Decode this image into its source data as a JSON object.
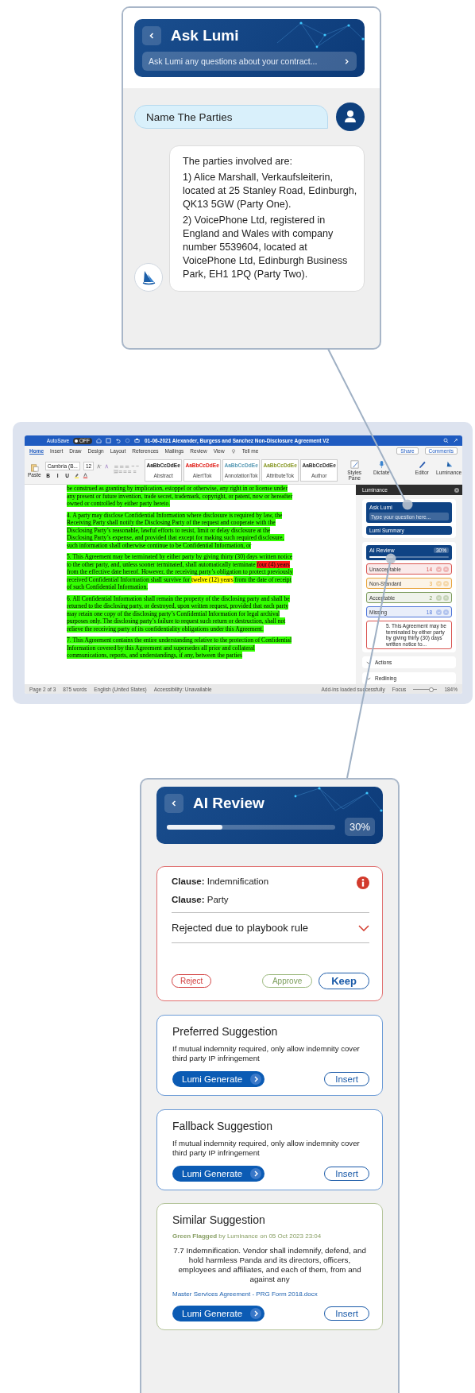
{
  "ask_lumi_panel": {
    "title": "Ask Lumi",
    "placeholder": "Ask Lumi any questions about your contract...",
    "messages": [
      {
        "kind": "user",
        "lines": [
          "Name The Parties"
        ]
      },
      {
        "kind": "bot",
        "lines": [
          "The parties involved are:",
          "1) Alice Marshall, Verkaufsleiterin, located at 25 Stanley Road, Edinburgh, QK13 5GW (Party One).",
          "2) VoicePhone Ltd, registered in England and Wales with company number 5539604, located at VoicePhone Ltd, Edinburgh Business Park, EH1 1PQ (Party Two)."
        ]
      }
    ]
  },
  "word_window": {
    "autosave": {
      "label": "AutoSave",
      "on": false,
      "state_text": "OFF"
    },
    "title": "01-06-2021 Alexander, Burgess and Sanchez Non-Disclosure Agreement V2",
    "tabs": [
      {
        "label": "Home",
        "selected": true
      },
      {
        "label": "Insert",
        "selected": false
      },
      {
        "label": "Draw",
        "selected": false
      },
      {
        "label": "Design",
        "selected": false
      },
      {
        "label": "Layout",
        "selected": false
      },
      {
        "label": "References",
        "selected": false
      },
      {
        "label": "Mailings",
        "selected": false
      },
      {
        "label": "Review",
        "selected": false
      },
      {
        "label": "View",
        "selected": false
      }
    ],
    "tell_me": "Tell me",
    "share": "Share",
    "comments": "Comments",
    "paste": "Paste",
    "font": "Cambria (B...",
    "font_size": "12",
    "format_buttons": [
      "B",
      "I",
      "U"
    ],
    "styles": [
      {
        "sample": "AaBbCcDdEe",
        "name": "Abstract",
        "color": "#222222"
      },
      {
        "sample": "AaBbCcDdEe",
        "name": "AlertTok",
        "color": "#e0201a"
      },
      {
        "sample": "AaBbCcDdEe",
        "name": "AnnotationTok",
        "color": "#5a9bb5"
      },
      {
        "sample": "AaBbCcDdEe",
        "name": "AttributeTok",
        "color": "#8a9a2a"
      },
      {
        "sample": "AaBbCcDdEe",
        "name": "Author",
        "color": "#333333"
      }
    ],
    "ribbon_buttons": [
      {
        "kind": "styles",
        "label": "Styles Pane"
      },
      {
        "kind": "dictate",
        "label": "Dictate"
      },
      {
        "kind": "editor",
        "label": "Editor"
      },
      {
        "kind": "luminance",
        "label": "Luminance"
      }
    ],
    "document": {
      "paragraphs": [
        {
          "segments": [
            {
              "text": "be construed as granting by implication, estoppel or otherwise, any right in or license under any present or future invention, trade secret, trademark, copyright, or patent, now or hereafter owned or controlled by either party hereto.",
              "color": "#33ff00"
            }
          ]
        },
        {
          "segments": [
            {
              "text": "4. A party may disclose Confidential Information where disclosure is required by law, the Receiving Party shall notify the Disclosing Party of the request and cooperate with the Disclosing Party’s reasonable, lawful efforts to resist, limit or delay disclosure at the Disclosing Party’s expense, and provided that except for making such required disclosure, such information shall otherwise continue to be Confidential Information, or",
              "color": "#33ff00"
            }
          ]
        },
        {
          "segments": [
            {
              "text": "5. This Agreement may be terminated by either party by giving thirty (30) days written notice to the other party, and, unless sooner terminated, shall automatically terminate ",
              "color": "#33ff00"
            },
            {
              "text": "four (4) years",
              "color": "#ff1a1a"
            },
            {
              "text": " from the effective date hereof. However, the receiving party’s obligation to protect previously received Confidential Information shall survive for ",
              "color": "#33ff00"
            },
            {
              "text": "twelve (12) years",
              "color": "#ffff00"
            },
            {
              "text": " from the date of receipt of such Confidential Information.",
              "color": "#33ff00"
            }
          ]
        },
        {
          "segments": [
            {
              "text": "6. All Confidential Information shall remain the property of the disclosing party and shall be returned to the disclosing party, or destroyed, upon written request, provided that each party may retain one copy of the disclosing party’s Confidential Information for legal archival purposes only. The disclosing party’s failure to request such return or destruction, shall not relieve the receiving party of its confidentiality obligations under this Agreement.",
              "color": "#33ff00"
            }
          ]
        },
        {
          "segments": [
            {
              "text": "7. This Agreement contains the entire understanding relative to the protection of Confidential Information covered by this Agreement and supersedes all prior and collateral communications, reports, and understandings, if any, between the parties",
              "color": "#33ff00"
            }
          ]
        }
      ]
    },
    "luminance_pane": {
      "title": "Luminance",
      "ask_title": "Ask Lumi",
      "ask_placeholder": "Type your question here...",
      "summary": "Lumi Summary",
      "review_title": "AI Review",
      "review_reading": "30%",
      "review_progress": {
        "level": 0.3
      },
      "categories": [
        {
          "label": "Unacceptable",
          "count": "14",
          "color": "#d9534f"
        },
        {
          "label": "Non-Standard",
          "count": "3",
          "color": "#e8a33a"
        },
        {
          "label": "Acceptable",
          "count": "2",
          "color": "#7a9a5a"
        },
        {
          "label": "Missing",
          "count": "18",
          "color": "#4a72d8"
        }
      ],
      "preview": "5. This Agreement may be terminated by either party by giving thirty (30) days written notice to...",
      "sections": [
        {
          "label": "Actions",
          "expanded": true
        },
        {
          "label": "Redlining",
          "expanded": true
        }
      ]
    },
    "status_bar": {
      "left": [
        "Page 2 of 3",
        "875 words",
        "English (United States)",
        "Accessibility: Unavailable"
      ],
      "right": [
        "Add-ins loaded successfully",
        "Focus"
      ],
      "zoom_slider": {
        "level": 0.72
      },
      "zoom": "184%"
    }
  },
  "ai_review_panel": {
    "title": "AI Review",
    "progress": {
      "level": 0.33,
      "reading": "30%"
    },
    "issue": {
      "clauses": [
        {
          "label": "Clause:",
          "value": "Indemnification"
        },
        {
          "label": "Clause:",
          "value": "Party"
        }
      ],
      "reason": "Rejected due to playbook rule",
      "expanded": false,
      "actions": [
        {
          "kind": "reject",
          "label": "Reject"
        },
        {
          "kind": "approve",
          "label": "Approve"
        },
        {
          "kind": "keep",
          "label": "Keep"
        }
      ]
    },
    "suggestions": [
      {
        "kind": "preferred",
        "title": "Preferred Suggestion",
        "text": "If mutual indemnity required, only allow indemnity cover third party IP infringement",
        "generate": "Lumi Generate",
        "insert": "Insert"
      },
      {
        "kind": "fallback",
        "title": "Fallback Suggestion",
        "text": "If mutual indemnity required, only allow indemnity cover third party IP infringement",
        "generate": "Lumi Generate",
        "insert": "Insert"
      },
      {
        "kind": "similar",
        "title": "Similar Suggestion",
        "flag": "**Green Flagged** by Luminance on 05 Oct 2023 23:04",
        "text": "7.7 Indemnification. Vendor shall indemnify, defend, and hold harmless Panda and its directors, officers, employees and affiliates, and each of them, from and against any",
        "source": "Master Services Agreement - PRG Form 2018.docx",
        "generate": "Lumi Generate",
        "insert": "Insert"
      }
    ]
  }
}
